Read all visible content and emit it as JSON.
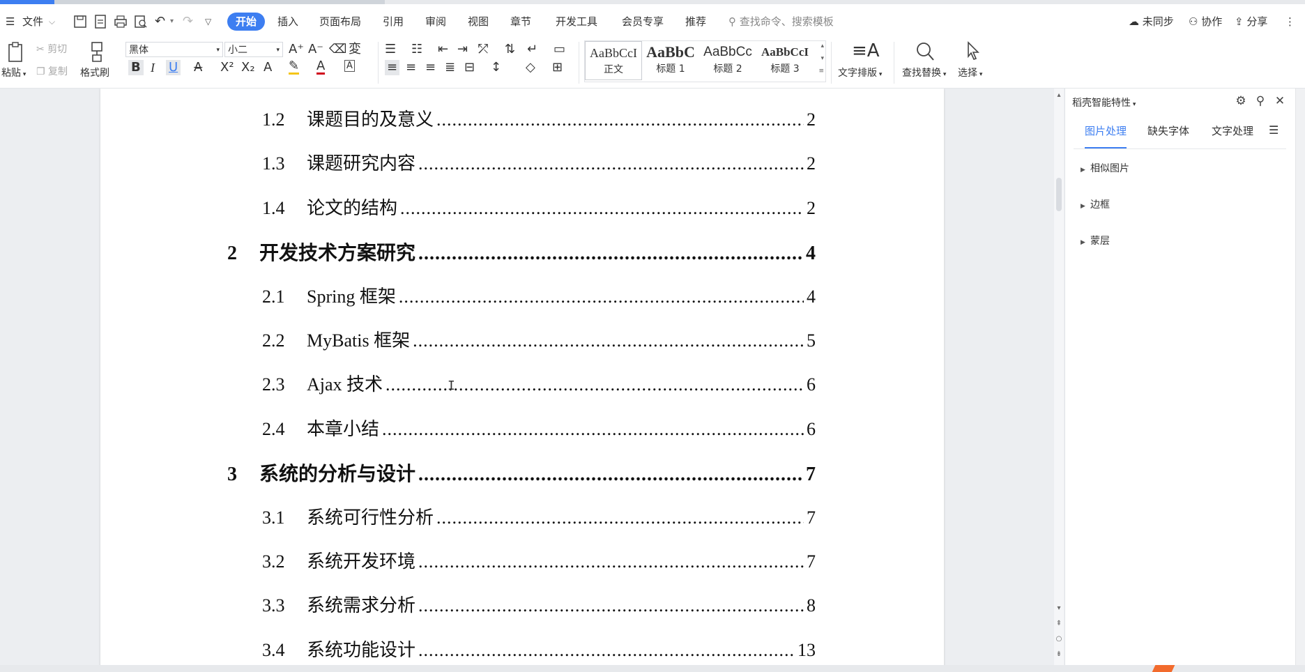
{
  "ribbon": {
    "menu_icon": "hamburger-icon",
    "file_label": "文件",
    "tabs": [
      "开始",
      "插入",
      "页面布局",
      "引用",
      "审阅",
      "视图",
      "章节",
      "开发工具",
      "会员专享",
      "推荐"
    ],
    "search_placeholder": "查找命令、搜索模板",
    "sync_label": "未同步",
    "collab_label": "协作",
    "share_label": "分享"
  },
  "toolbar": {
    "paste": "粘贴",
    "cut": "剪切",
    "copy": "复制",
    "format_painter": "格式刷",
    "font_name": "黑体",
    "font_size": "小二",
    "styles": [
      {
        "sample": "AaBbCcI",
        "name": "正文"
      },
      {
        "sample": "AaBbC",
        "name": "标题 1"
      },
      {
        "sample": "AaBbCc",
        "name": "标题 2"
      },
      {
        "sample": "AaBbCcI",
        "name": "标题 3"
      }
    ],
    "text_layout": "文字排版",
    "find_replace": "查找替换",
    "select": "选择"
  },
  "toc": [
    {
      "num": "1.2",
      "title": "课题目的及意义",
      "page": "2",
      "level": 2
    },
    {
      "num": "1.3",
      "title": "课题研究内容",
      "page": "2",
      "level": 2
    },
    {
      "num": "1.4",
      "title": "论文的结构",
      "page": "2",
      "level": 2
    },
    {
      "num": "2",
      "title": "开发技术方案研究",
      "page": "4",
      "level": 1
    },
    {
      "num": "2.1",
      "title": "Spring 框架",
      "page": "4",
      "level": 2
    },
    {
      "num": "2.2",
      "title": "MyBatis 框架",
      "page": "5",
      "level": 2
    },
    {
      "num": "2.3",
      "title": "Ajax 技术",
      "page": "6",
      "level": 2
    },
    {
      "num": "2.4",
      "title": "本章小结",
      "page": "6",
      "level": 2
    },
    {
      "num": "3",
      "title": "系统的分析与设计",
      "page": "7",
      "level": 1
    },
    {
      "num": "3.1",
      "title": "系统可行性分析",
      "page": "7",
      "level": 2
    },
    {
      "num": "3.2",
      "title": "系统开发环境",
      "page": "7",
      "level": 2
    },
    {
      "num": "3.3",
      "title": "系统需求分析",
      "page": "8",
      "level": 2
    },
    {
      "num": "3.4",
      "title": "系统功能设计",
      "page": "13",
      "level": 2
    }
  ],
  "pane": {
    "title": "稻壳智能特性",
    "tabs": [
      "图片处理",
      "缺失字体",
      "文字处理"
    ],
    "active_tab": 0,
    "items": [
      "相似图片",
      "边框",
      "蒙层"
    ]
  }
}
